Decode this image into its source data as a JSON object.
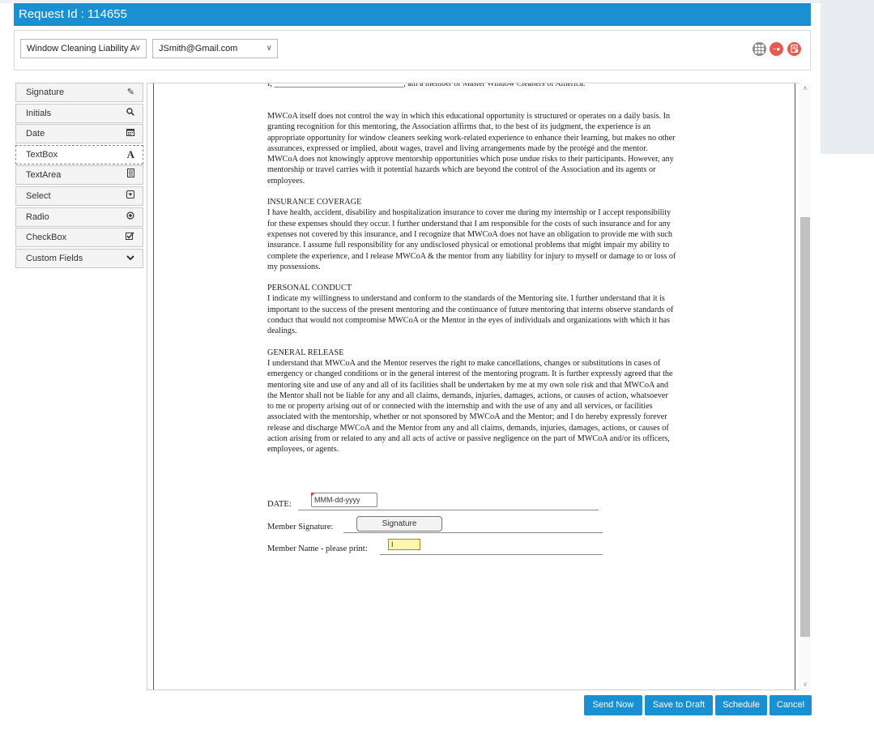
{
  "header": {
    "title": "Request Id : 114655"
  },
  "toolbar": {
    "document_select": "Window Cleaning Liability A",
    "recipient_select": "JSmith@Gmail.com",
    "icons": [
      "grid-icon",
      "remove-user-icon",
      "document-settings-icon"
    ]
  },
  "fields": [
    {
      "label": "Signature",
      "icon": "pencil-icon"
    },
    {
      "label": "Initials",
      "icon": "search-icon"
    },
    {
      "label": "Date",
      "icon": "calendar-icon"
    },
    {
      "label": "TextBox",
      "icon": "text-a-icon"
    },
    {
      "label": "TextArea",
      "icon": "textarea-icon"
    },
    {
      "label": "Select",
      "icon": "select-icon"
    },
    {
      "label": "Radio",
      "icon": "radio-icon"
    },
    {
      "label": "CheckBox",
      "icon": "checkbox-icon"
    },
    {
      "label": "Custom Fields",
      "icon": "chevron-down-icon"
    }
  ],
  "document": {
    "top_line": "I, ________________________________, am a member of Master Window Cleaners of America.",
    "para1": "MWCoA itself does not control the way in which this educational opportunity is structured or operates on a daily basis. In granting recognition for this mentoring, the Association affirms that, to the best of its judgment, the experience is an appropriate opportunity for window cleaners seeking work-related experience to enhance their learning, but makes no other assurances, expressed or implied, about wages, travel and living arrangements made by the protégé and the mentor.",
    "para2": "MWCoA does not knowingly approve mentorship opportunities which pose undue risks to their participants. However, any mentorship or travel carries with it potential hazards which are beyond the control of the Association and its agents or employees.",
    "insurance_heading": "INSURANCE COVERAGE",
    "insurance_text": "I have health, accident, disability and hospitalization insurance to cover me during my internship or I accept responsibility for these expenses should they occur. I further understand that I am responsible for the costs of such insurance and for any expenses not covered by this insurance, and I recognize that MWCoA does not have an obligation to provide me with such insurance. I assume full responsibility for any undisclosed physical or emotional problems that might impair my ability to complete the experience, and I release MWCoA & the mentor from any liability for injury to myself or damage to or loss of my possessions.",
    "conduct_heading": "PERSONAL CONDUCT",
    "conduct_text": "I indicate my willingness to understand and conform to the standards of the Mentoring site. I further understand that it is important to the success of the present mentoring and the continuance of future mentoring that interns observe standards of conduct that would not compromise MWCoA or the Mentor in the eyes of individuals and organizations with which it has dealings.",
    "release_heading": "GENERAL RELEASE",
    "release_text": "I understand that MWCoA and the Mentor reserves the right to make cancellations, changes or substitutions in cases of emergency or changed conditions or in the general interest of the mentoring program. It is further expressly agreed that the mentoring site and use of any and all of its facilities shall be undertaken by me at my own sole risk and that MWCoA and the Mentor shall not be liable for any and all claims, demands, injuries, damages, actions, or causes of action, whatsoever to me or property arising out of or connected with the internship and with the use of any and all services, or facilities associated with the mentorship, whether or not sponsored by MWCoA and the Mentor; and I do hereby expressly forever release and discharge MWCoA and the Mentor from any and all claims, demands, injuries, damages, actions, or causes of action arising from or related to any and all acts of active or passive negligence on the part of MWCoA and/or its officers, employees, or agents.",
    "date_label": "DATE:",
    "date_placeholder": "MMM-dd-yyyy",
    "signature_label": "Member Signature:",
    "signature_field": "Signature",
    "name_label": "Member Name - please print:",
    "name_field": "I"
  },
  "actions": {
    "send_now": "Send Now",
    "save_draft": "Save to Draft",
    "schedule": "Schedule",
    "cancel": "Cancel"
  },
  "colors": {
    "primary": "#1a8fd1",
    "alert": "#e55b4d",
    "highlight_field": "#fff7b0"
  }
}
